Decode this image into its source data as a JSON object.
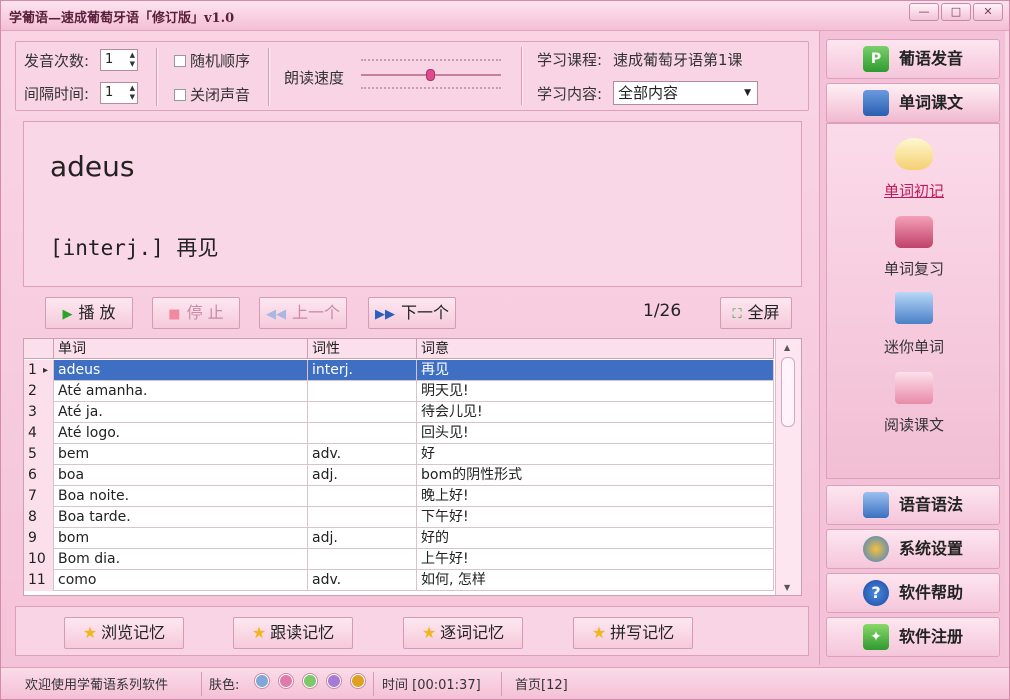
{
  "window": {
    "title": "学葡语—速成葡萄牙语「修订版」v1.0",
    "controls": {
      "minimize": "—",
      "restore": "□",
      "close": "✕"
    }
  },
  "settings": {
    "pronounce_count_label": "发音次数:",
    "pronounce_count_value": "1",
    "interval_label": "间隔时间:",
    "interval_value": "1",
    "random_order": "随机顺序",
    "mute": "关闭声音",
    "speed_label": "朗读速度",
    "speed_level": 0.5,
    "course_label": "学习课程:",
    "course_value": "速成葡萄牙语第1课",
    "content_label": "学习内容:",
    "content_value": "全部内容"
  },
  "display": {
    "word": "adeus",
    "meaning": "[interj.] 再见"
  },
  "controls": {
    "play": "播 放",
    "stop": "停 止",
    "prev": "上一个",
    "next": "下一个",
    "counter": "1/26",
    "fullscreen": "全屏"
  },
  "table": {
    "headers": [
      "单词",
      "词性",
      "词意"
    ],
    "rows": [
      {
        "num": "1",
        "word": "adeus",
        "pos": "interj.",
        "meaning": "再见"
      },
      {
        "num": "2",
        "word": "Até amanha.",
        "pos": "",
        "meaning": "明天见!"
      },
      {
        "num": "3",
        "word": "Até ja.",
        "pos": "",
        "meaning": "待会儿见!"
      },
      {
        "num": "4",
        "word": "Até logo.",
        "pos": "",
        "meaning": "回头见!"
      },
      {
        "num": "5",
        "word": "bem",
        "pos": "adv.",
        "meaning": "好"
      },
      {
        "num": "6",
        "word": "boa",
        "pos": "adj.",
        "meaning": "bom的阴性形式"
      },
      {
        "num": "7",
        "word": "Boa noite.",
        "pos": "",
        "meaning": "晚上好!"
      },
      {
        "num": "8",
        "word": "Boa tarde.",
        "pos": "",
        "meaning": "下午好!"
      },
      {
        "num": "9",
        "word": "bom",
        "pos": "adj.",
        "meaning": "好的"
      },
      {
        "num": "10",
        "word": "Bom dia.",
        "pos": "",
        "meaning": "上午好!"
      },
      {
        "num": "11",
        "word": "como",
        "pos": "adv.",
        "meaning": "如何, 怎样"
      }
    ]
  },
  "memory": {
    "browse": "浏览记忆",
    "follow": "跟读记忆",
    "word_by_word": "逐词记忆",
    "spelling": "拼写记忆"
  },
  "status": {
    "welcome": "欢迎使用学葡语系列软件",
    "skin_label": "肤色:",
    "skin_colors": [
      "#7fa8d8",
      "#e07aa8",
      "#7cc86a",
      "#a77ad6",
      "#e0a020"
    ],
    "time": "时间 [00:01:37]",
    "home": "首页[12]"
  },
  "sidebar": {
    "pronunciation": "葡语发音",
    "vocab_text": "单词课文",
    "sub_items": [
      "单词初记",
      "单词复习",
      "迷你单词",
      "阅读课文"
    ],
    "grammar": "语音语法",
    "settings": "系统设置",
    "help": "软件帮助",
    "register": "软件注册"
  }
}
